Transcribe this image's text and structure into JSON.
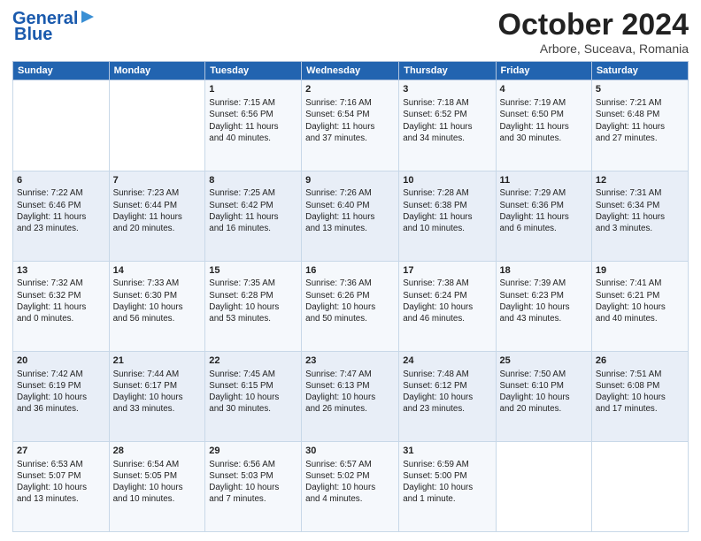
{
  "header": {
    "logo_line1": "General",
    "logo_line2": "Blue",
    "month": "October 2024",
    "location": "Arbore, Suceava, Romania"
  },
  "weekdays": [
    "Sunday",
    "Monday",
    "Tuesday",
    "Wednesday",
    "Thursday",
    "Friday",
    "Saturday"
  ],
  "weeks": [
    [
      {
        "day": "",
        "text": ""
      },
      {
        "day": "",
        "text": ""
      },
      {
        "day": "1",
        "text": "Sunrise: 7:15 AM\nSunset: 6:56 PM\nDaylight: 11 hours\nand 40 minutes."
      },
      {
        "day": "2",
        "text": "Sunrise: 7:16 AM\nSunset: 6:54 PM\nDaylight: 11 hours\nand 37 minutes."
      },
      {
        "day": "3",
        "text": "Sunrise: 7:18 AM\nSunset: 6:52 PM\nDaylight: 11 hours\nand 34 minutes."
      },
      {
        "day": "4",
        "text": "Sunrise: 7:19 AM\nSunset: 6:50 PM\nDaylight: 11 hours\nand 30 minutes."
      },
      {
        "day": "5",
        "text": "Sunrise: 7:21 AM\nSunset: 6:48 PM\nDaylight: 11 hours\nand 27 minutes."
      }
    ],
    [
      {
        "day": "6",
        "text": "Sunrise: 7:22 AM\nSunset: 6:46 PM\nDaylight: 11 hours\nand 23 minutes."
      },
      {
        "day": "7",
        "text": "Sunrise: 7:23 AM\nSunset: 6:44 PM\nDaylight: 11 hours\nand 20 minutes."
      },
      {
        "day": "8",
        "text": "Sunrise: 7:25 AM\nSunset: 6:42 PM\nDaylight: 11 hours\nand 16 minutes."
      },
      {
        "day": "9",
        "text": "Sunrise: 7:26 AM\nSunset: 6:40 PM\nDaylight: 11 hours\nand 13 minutes."
      },
      {
        "day": "10",
        "text": "Sunrise: 7:28 AM\nSunset: 6:38 PM\nDaylight: 11 hours\nand 10 minutes."
      },
      {
        "day": "11",
        "text": "Sunrise: 7:29 AM\nSunset: 6:36 PM\nDaylight: 11 hours\nand 6 minutes."
      },
      {
        "day": "12",
        "text": "Sunrise: 7:31 AM\nSunset: 6:34 PM\nDaylight: 11 hours\nand 3 minutes."
      }
    ],
    [
      {
        "day": "13",
        "text": "Sunrise: 7:32 AM\nSunset: 6:32 PM\nDaylight: 11 hours\nand 0 minutes."
      },
      {
        "day": "14",
        "text": "Sunrise: 7:33 AM\nSunset: 6:30 PM\nDaylight: 10 hours\nand 56 minutes."
      },
      {
        "day": "15",
        "text": "Sunrise: 7:35 AM\nSunset: 6:28 PM\nDaylight: 10 hours\nand 53 minutes."
      },
      {
        "day": "16",
        "text": "Sunrise: 7:36 AM\nSunset: 6:26 PM\nDaylight: 10 hours\nand 50 minutes."
      },
      {
        "day": "17",
        "text": "Sunrise: 7:38 AM\nSunset: 6:24 PM\nDaylight: 10 hours\nand 46 minutes."
      },
      {
        "day": "18",
        "text": "Sunrise: 7:39 AM\nSunset: 6:23 PM\nDaylight: 10 hours\nand 43 minutes."
      },
      {
        "day": "19",
        "text": "Sunrise: 7:41 AM\nSunset: 6:21 PM\nDaylight: 10 hours\nand 40 minutes."
      }
    ],
    [
      {
        "day": "20",
        "text": "Sunrise: 7:42 AM\nSunset: 6:19 PM\nDaylight: 10 hours\nand 36 minutes."
      },
      {
        "day": "21",
        "text": "Sunrise: 7:44 AM\nSunset: 6:17 PM\nDaylight: 10 hours\nand 33 minutes."
      },
      {
        "day": "22",
        "text": "Sunrise: 7:45 AM\nSunset: 6:15 PM\nDaylight: 10 hours\nand 30 minutes."
      },
      {
        "day": "23",
        "text": "Sunrise: 7:47 AM\nSunset: 6:13 PM\nDaylight: 10 hours\nand 26 minutes."
      },
      {
        "day": "24",
        "text": "Sunrise: 7:48 AM\nSunset: 6:12 PM\nDaylight: 10 hours\nand 23 minutes."
      },
      {
        "day": "25",
        "text": "Sunrise: 7:50 AM\nSunset: 6:10 PM\nDaylight: 10 hours\nand 20 minutes."
      },
      {
        "day": "26",
        "text": "Sunrise: 7:51 AM\nSunset: 6:08 PM\nDaylight: 10 hours\nand 17 minutes."
      }
    ],
    [
      {
        "day": "27",
        "text": "Sunrise: 6:53 AM\nSunset: 5:07 PM\nDaylight: 10 hours\nand 13 minutes."
      },
      {
        "day": "28",
        "text": "Sunrise: 6:54 AM\nSunset: 5:05 PM\nDaylight: 10 hours\nand 10 minutes."
      },
      {
        "day": "29",
        "text": "Sunrise: 6:56 AM\nSunset: 5:03 PM\nDaylight: 10 hours\nand 7 minutes."
      },
      {
        "day": "30",
        "text": "Sunrise: 6:57 AM\nSunset: 5:02 PM\nDaylight: 10 hours\nand 4 minutes."
      },
      {
        "day": "31",
        "text": "Sunrise: 6:59 AM\nSunset: 5:00 PM\nDaylight: 10 hours\nand 1 minute."
      },
      {
        "day": "",
        "text": ""
      },
      {
        "day": "",
        "text": ""
      }
    ]
  ]
}
